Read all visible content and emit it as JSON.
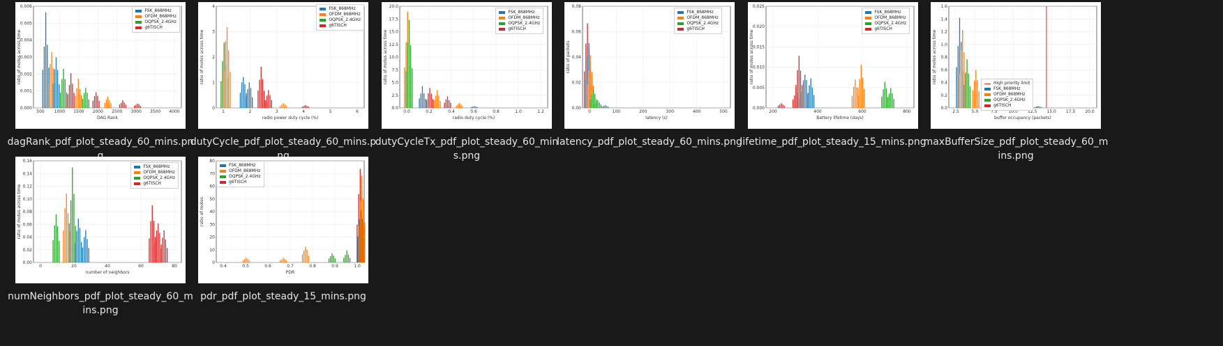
{
  "colors": {
    "FSK_868MHz": "#1f77b4",
    "OFDM_868MHz": "#ff7f0e",
    "OQPSK_2.4GHz": "#2ca02c",
    "g6TISCH": "#d62728"
  },
  "files": [
    {
      "name": "dagRank_pdf_plot_steady_60_mins.png",
      "chart": {
        "xlabel": "DAG Rank",
        "ylabel": "ratio of motes across time",
        "xticks": [
          "500",
          "1000",
          "1500",
          "2000",
          "2500",
          "3000",
          "3500",
          "4000"
        ],
        "yticks": [
          "0.000",
          "0.001",
          "0.002",
          "0.003",
          "0.004",
          "0.005",
          "0.006"
        ],
        "legend": [
          "FSK_868MHz",
          "OFDM_868MHz",
          "OQPSK_2.4GHz",
          "g6TISCH"
        ]
      }
    },
    {
      "name": "dutyCycle_pdf_plot_steady_60_mins.png",
      "chart": {
        "xlabel": "radio power duty cycle (%)",
        "ylabel": "ratio of motes across time",
        "xticks": [
          "1",
          "2",
          "3",
          "4",
          "5",
          "6"
        ],
        "yticks": [
          "0",
          "1",
          "2",
          "3",
          "4"
        ],
        "legend": [
          "FSK_868MHz",
          "OFDM_868MHz",
          "OQPSK_2.4GHz",
          "g6TISCH"
        ]
      }
    },
    {
      "name": "dutyCycleTx_pdf_plot_steady_60_mins.png",
      "chart": {
        "xlabel": "radio duty cycle (%)",
        "ylabel": "ratio of motes across time",
        "xticks": [
          "0.0",
          "0.2",
          "0.4",
          "0.6",
          "0.8",
          "1.0",
          "1.2"
        ],
        "yticks": [
          "0.0",
          "2.5",
          "5.0",
          "7.5",
          "10.0",
          "12.5",
          "15.0",
          "17.5",
          "20.0"
        ],
        "legend": [
          "FSK_868MHz",
          "OFDM_868MHz",
          "OQPSK_2.4GHz",
          "g6TISCH"
        ]
      }
    },
    {
      "name": "latency_pdf_plot_steady_60_mins.png",
      "chart": {
        "xlabel": "latency (s)",
        "ylabel": "ratio of packets",
        "xticks": [
          "0",
          "100",
          "200",
          "300",
          "400",
          "500"
        ],
        "yticks": [
          "0.00",
          "0.02",
          "0.04",
          "0.06",
          "0.08"
        ],
        "legend": [
          "FSK_868MHz",
          "OFDM_868MHz",
          "OQPSK_2.4GHz",
          "g6TISCH"
        ]
      }
    },
    {
      "name": "lifetime_pdf_plot_steady_15_mins.png",
      "chart": {
        "xlabel": "Battery lifetime (days)",
        "ylabel": "ratio of motes across time",
        "xticks": [
          "200",
          "400",
          "600",
          "800"
        ],
        "yticks": [
          "0.000",
          "0.005",
          "0.010",
          "0.015",
          "0.020",
          "0.025"
        ],
        "legend": [
          "FSK_868MHz",
          "OFDM_868MHz",
          "OQPSK_2.4GHz",
          "g6TISCH"
        ]
      }
    },
    {
      "name": "maxBufferSize_pdf_plot_steady_60_mins.png",
      "chart": {
        "xlabel": "buffer occupancy (packets)",
        "ylabel": "ratio of motes across time",
        "xticks": [
          "2.5",
          "5.0",
          "7.5",
          "10.0",
          "12.5",
          "15.0",
          "17.5",
          "20.0"
        ],
        "yticks": [
          "0.0",
          "0.2",
          "0.4",
          "0.6",
          "0.8",
          "1.0",
          "1.2",
          "1.4",
          "1.6"
        ],
        "legend": [
          "High priority limit",
          "FSK_868MHz",
          "OFDM_868MHz",
          "OQPSK_2.4GHz",
          "g6TISCH"
        ]
      }
    },
    {
      "name": "numNeighbors_pdf_plot_steady_60_mins.png",
      "chart": {
        "xlabel": "number of neighbors",
        "ylabel": "ratio of motes across time",
        "xticks": [
          "0",
          "20",
          "40",
          "60",
          "80"
        ],
        "yticks": [
          "0.00",
          "0.02",
          "0.04",
          "0.06",
          "0.08",
          "0.10",
          "0.12",
          "0.14",
          "0.16"
        ],
        "legend": [
          "FSK_868MHz",
          "OFDM_868MHz",
          "OQPSK_2.4GHz",
          "g6TISCH"
        ]
      }
    },
    {
      "name": "pdr_pdf_plot_steady_15_mins.png",
      "chart": {
        "xlabel": "PDR",
        "ylabel": "ratio of motes",
        "xticks": [
          "0.4",
          "0.5",
          "0.6",
          "0.7",
          "0.8",
          "0.9",
          "1.0"
        ],
        "yticks": [
          "0",
          "10",
          "20",
          "30",
          "40",
          "50",
          "60",
          "70",
          "80"
        ],
        "legend": [
          "FSK_868MHz",
          "OFDM_868MHz",
          "OQPSK_2.4GHz",
          "g6TISCH"
        ]
      }
    }
  ]
}
